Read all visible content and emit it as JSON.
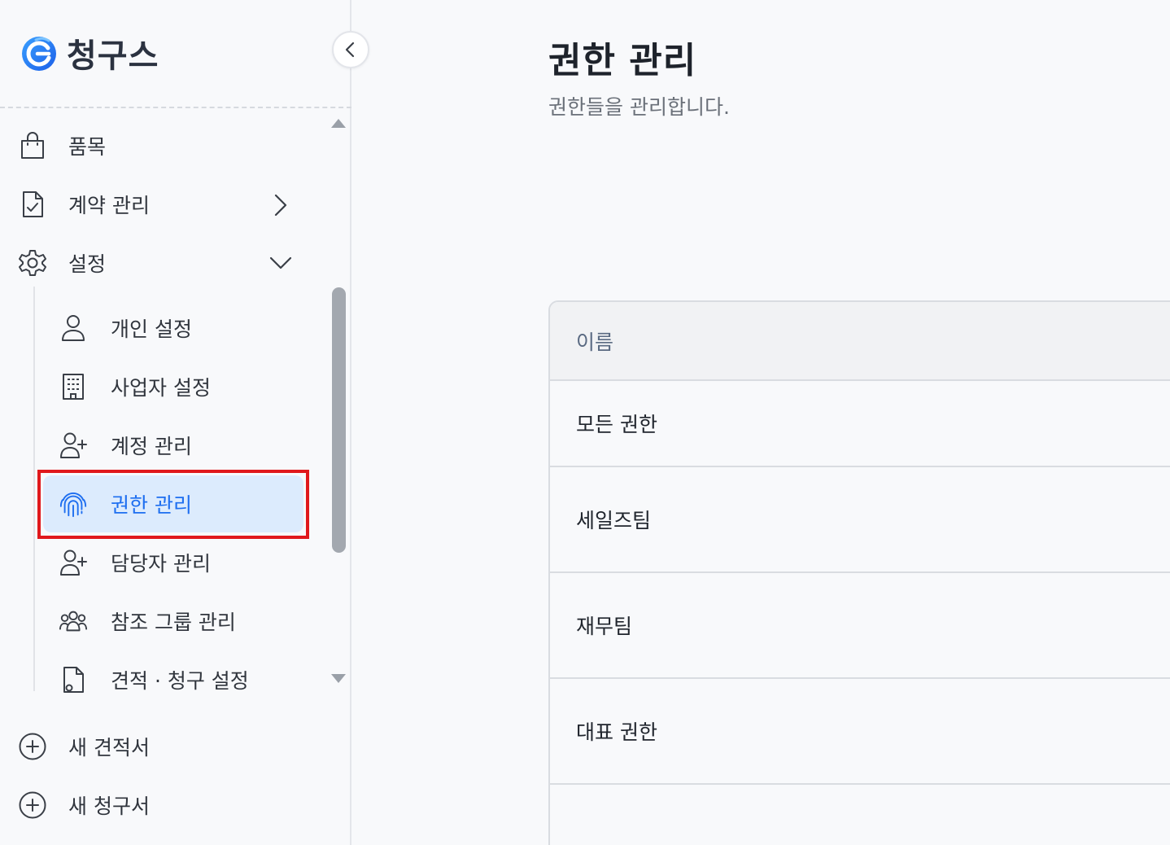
{
  "app": {
    "name": "청구스",
    "brand_color": "#1d6ef0"
  },
  "sidebar": {
    "collapse_icon": "chevron-left-icon",
    "menu": [
      {
        "id": "items",
        "label": "품목",
        "icon": "shopping-bag-icon"
      },
      {
        "id": "contracts",
        "label": "계약 관리",
        "icon": "document-check-icon",
        "expandable": true,
        "expanded": false
      },
      {
        "id": "settings",
        "label": "설정",
        "icon": "gear-icon",
        "expandable": true,
        "expanded": true
      }
    ],
    "settings_children": [
      {
        "id": "personal",
        "label": "개인 설정",
        "icon": "user-icon"
      },
      {
        "id": "business",
        "label": "사업자 설정",
        "icon": "building-icon"
      },
      {
        "id": "accounts",
        "label": "계정 관리",
        "icon": "user-plus-icon"
      },
      {
        "id": "permissions",
        "label": "권한 관리",
        "icon": "fingerprint-icon",
        "active": true
      },
      {
        "id": "managers",
        "label": "담당자 관리",
        "icon": "user-plus-icon"
      },
      {
        "id": "ref-groups",
        "label": "참조 그룹 관리",
        "icon": "users-group-icon"
      },
      {
        "id": "quote-invoice",
        "label": "견적 · 청구 설정",
        "icon": "document-gear-icon"
      }
    ],
    "actions": [
      {
        "id": "new-quote",
        "label": "새 견적서",
        "icon": "plus-circle-icon"
      },
      {
        "id": "new-invoice",
        "label": "새 청구서",
        "icon": "plus-circle-icon"
      }
    ]
  },
  "main": {
    "title": "권한 관리",
    "subtitle": "권한들을 관리합니다.",
    "table": {
      "columns": [
        "이름"
      ],
      "rows": [
        "모든 권한",
        "세일즈팀",
        "재무팀",
        "대표 권한"
      ]
    }
  }
}
